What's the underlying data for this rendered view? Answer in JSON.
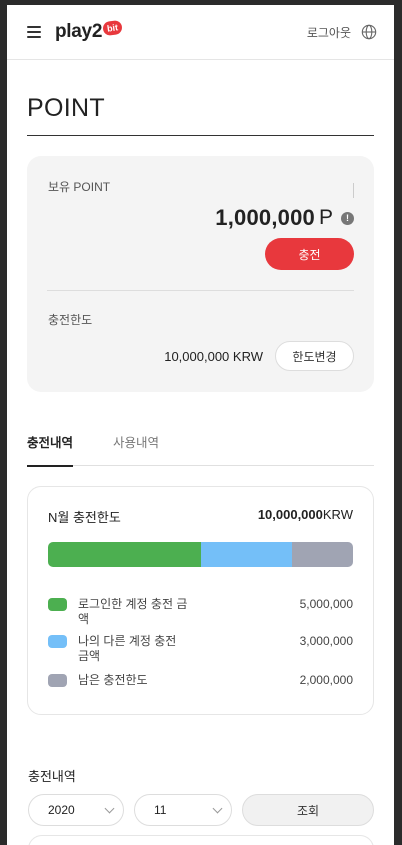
{
  "header": {
    "logo_text": "play2",
    "logo_badge": "bit",
    "logout_label": "로그아웃",
    "icons": [
      "menu-icon",
      "globe-icon"
    ]
  },
  "page": {
    "title": "POINT"
  },
  "point_card": {
    "balance_label": "보유 POINT",
    "balance_amount": "1,000,000",
    "balance_unit": "P",
    "info_icon_glyph": "!",
    "charge_button": "충전",
    "limit_label": "충전한도",
    "limit_value": "10,000,000 KRW",
    "limit_change_button": "한도변경"
  },
  "tabs": [
    {
      "label": "충전내역",
      "active": true
    },
    {
      "label": "사용내역",
      "active": false
    }
  ],
  "limit_breakdown": {
    "title": "N월 충전한도",
    "total_amount": "10,000,000",
    "total_unit": "KRW",
    "segments": [
      {
        "label": "로그인한 계정 충전 금액",
        "value": "5,000,000",
        "share": 0.5,
        "color": "#4caf50"
      },
      {
        "label": "나의 다른 계정 충전 금액",
        "value": "3,000,000",
        "share": 0.3,
        "color": "#74bff8"
      },
      {
        "label": "남은 충전한도",
        "value": "2,000,000",
        "share": 0.2,
        "color": "#a0a4b3"
      }
    ]
  },
  "history": {
    "title": "충전내역",
    "year_select": "2020",
    "month_select": "11",
    "search_button": "조회"
  },
  "colors": {
    "accent": "#e8383d"
  }
}
